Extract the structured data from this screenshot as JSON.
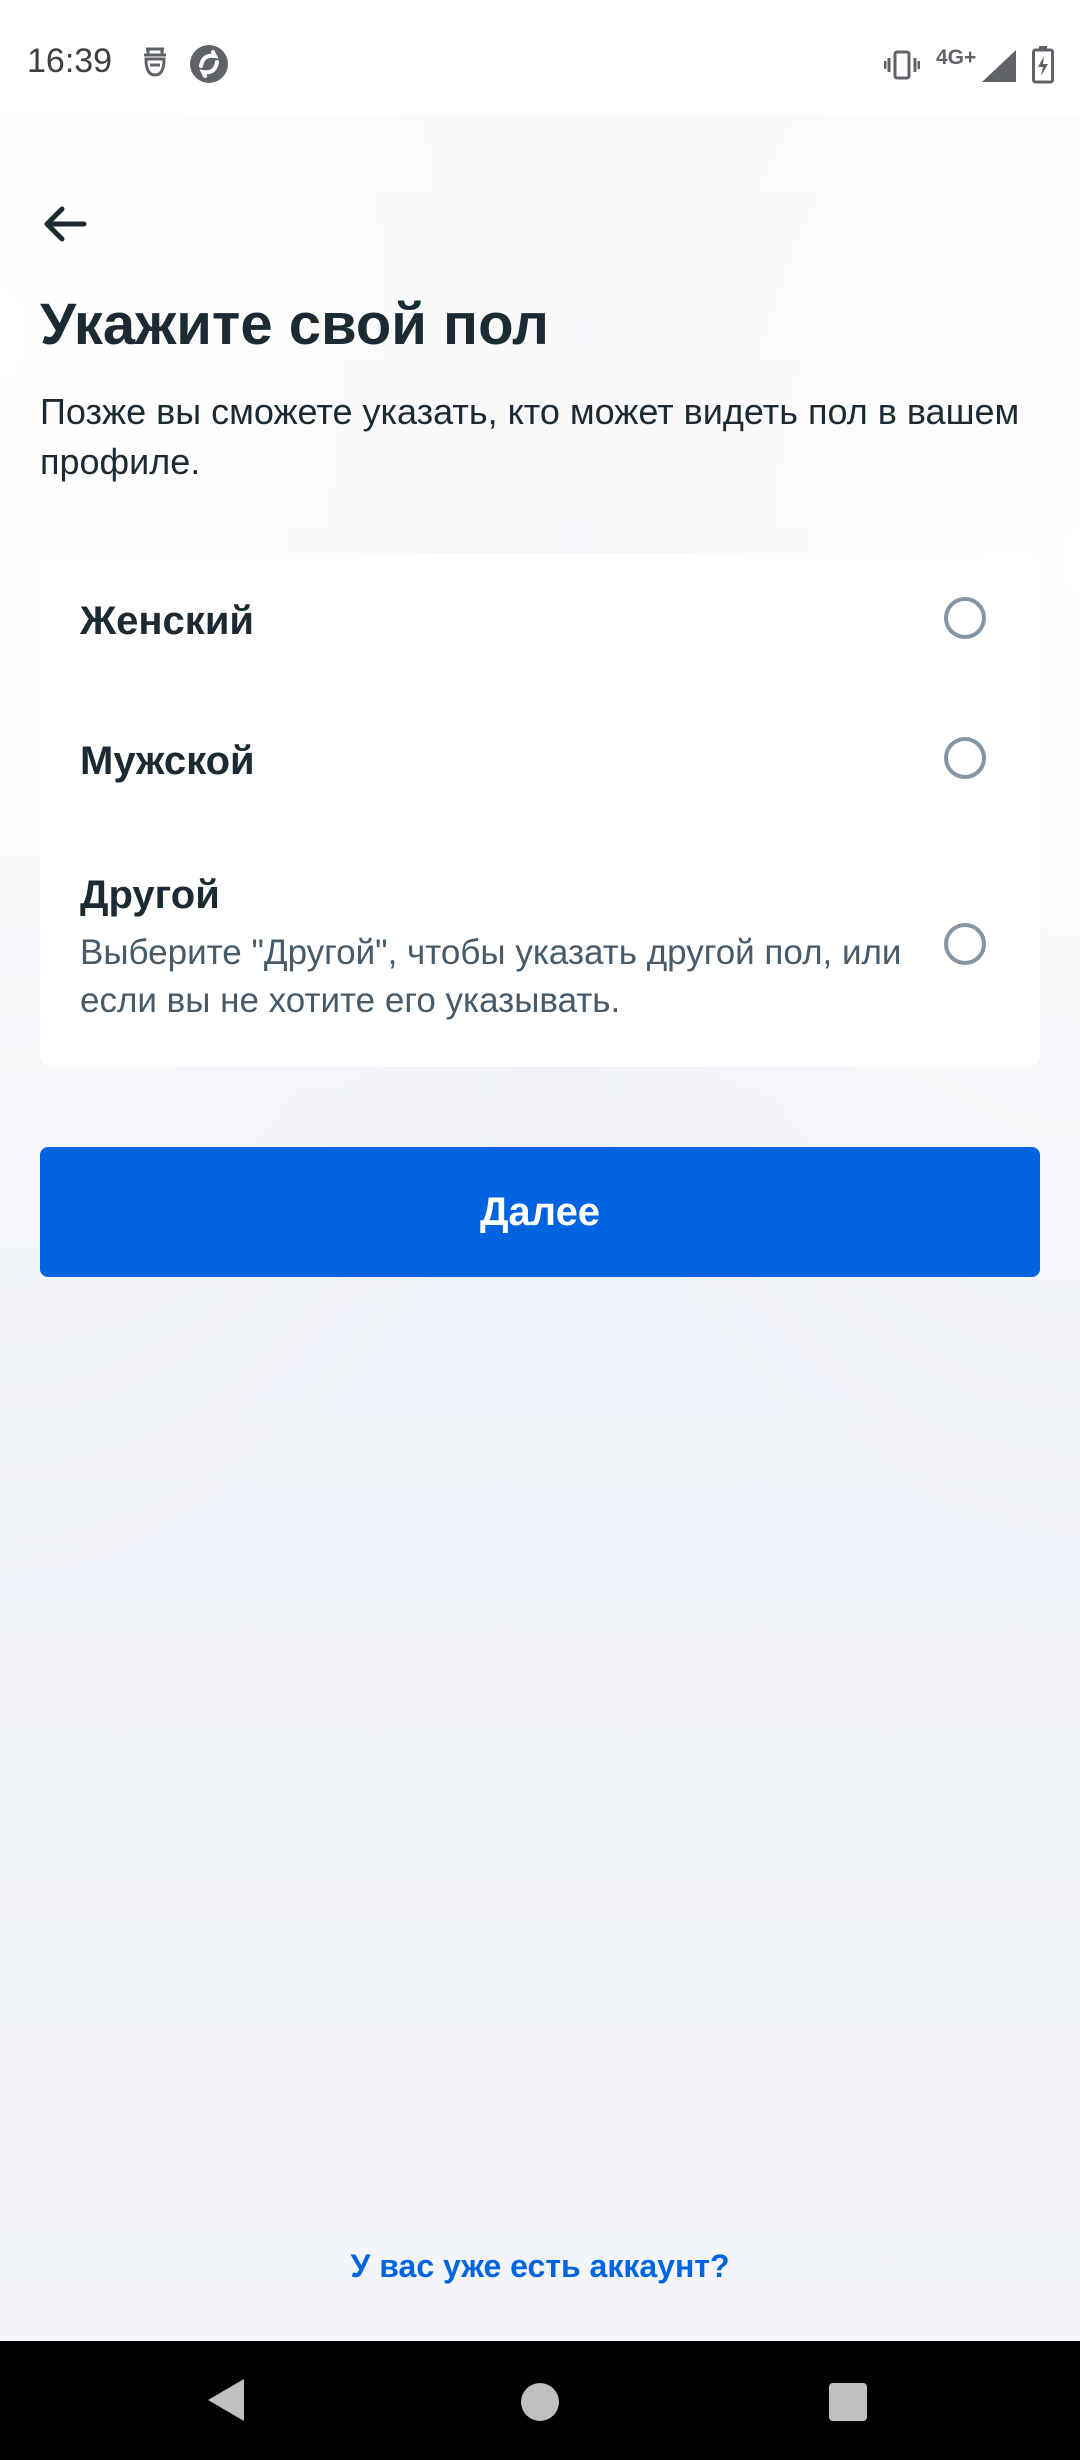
{
  "status_bar": {
    "time": "16:39",
    "network": "4G+",
    "icons": [
      "notification-app-icon",
      "browser-sync-icon",
      "vibrate-icon",
      "signal-icon",
      "battery-charging-icon"
    ]
  },
  "header": {
    "back_icon": "arrow-left-icon",
    "title": "Укажите свой пол",
    "subtitle": "Позже вы сможете указать, кто может видеть пол в вашем профиле."
  },
  "options": [
    {
      "label": "Женский",
      "description": "",
      "selected": false
    },
    {
      "label": "Мужской",
      "description": "",
      "selected": false
    },
    {
      "label": "Другой",
      "description": "Выберите \"Другой\", чтобы указать другой пол, или если вы не хотите его указывать.",
      "selected": false
    }
  ],
  "next_button": {
    "label": "Далее"
  },
  "footer": {
    "login_link": "У вас уже есть аккаунт?"
  },
  "colors": {
    "accent": "#0064e0",
    "text_primary": "#1c2b33",
    "text_secondary": "#465a69",
    "radio_border": "#8595a4"
  },
  "nav_bar": {
    "icons": [
      "nav-back-icon",
      "nav-home-icon",
      "nav-recents-icon"
    ]
  }
}
